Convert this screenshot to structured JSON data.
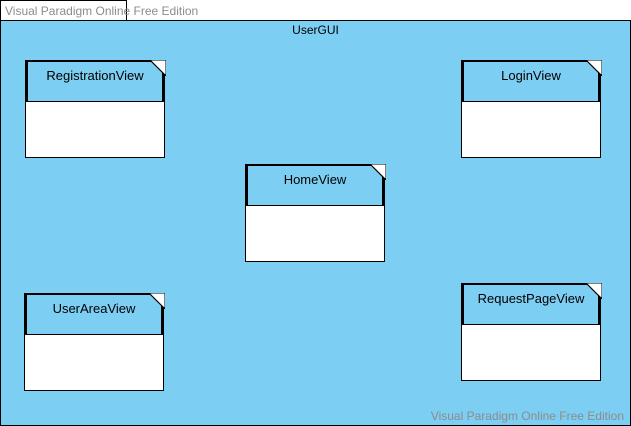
{
  "watermark": {
    "top": "Visual Paradigm Online Free Edition",
    "bottom": "Visual Paradigm Online Free Edition"
  },
  "package": {
    "name": "UserGUI"
  },
  "components": {
    "registration": {
      "label": "RegistrationView"
    },
    "login": {
      "label": "LoginView"
    },
    "home": {
      "label": "HomeView"
    },
    "userarea": {
      "label": "UserAreaView"
    },
    "requestpage": {
      "label": "RequestPageView"
    }
  },
  "colors": {
    "package_fill": "#7ccef3",
    "component_body": "#ffffff",
    "outline": "#000000",
    "watermark_text": "#8c8c8c"
  }
}
